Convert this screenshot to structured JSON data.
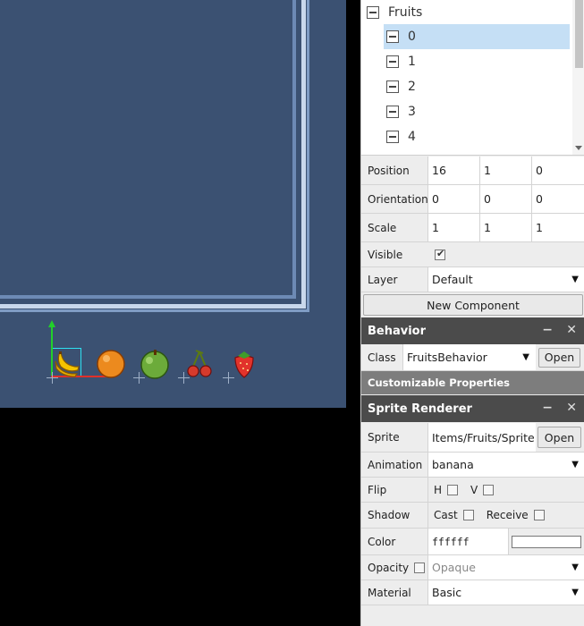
{
  "tree": {
    "root_label": "Fruits",
    "children": [
      "0",
      "1",
      "2",
      "3",
      "4"
    ],
    "selected": "0"
  },
  "transform": {
    "position_label": "Position",
    "position": [
      "16",
      "1",
      "0"
    ],
    "orientation_label": "Orientation",
    "orientation": [
      "0",
      "0",
      "0"
    ],
    "scale_label": "Scale",
    "scale": [
      "1",
      "1",
      "1"
    ],
    "visible_label": "Visible",
    "visible": true,
    "layer_label": "Layer",
    "layer": "Default"
  },
  "new_component_label": "New Component",
  "behavior": {
    "title": "Behavior",
    "class_label": "Class",
    "class_value": "FruitsBehavior",
    "open_label": "Open",
    "customizable_label": "Customizable Properties"
  },
  "sprite_renderer": {
    "title": "Sprite Renderer",
    "sprite_label": "Sprite",
    "sprite_value": "Items/Fruits/Sprite",
    "open_label": "Open",
    "animation_label": "Animation",
    "animation_value": "banana",
    "flip_label": "Flip",
    "flip_h_label": "H",
    "flip_v_label": "V",
    "shadow_label": "Shadow",
    "cast_label": "Cast",
    "receive_label": "Receive",
    "color_label": "Color",
    "color_value": "ffffff",
    "color_swatch": "#ffffff",
    "opacity_label": "Opacity",
    "opacity_value": "Opaque",
    "material_label": "Material",
    "material_value": "Basic"
  },
  "icons": {
    "minimize": "−",
    "close": "✕",
    "caret": "▼"
  },
  "scene": {
    "background": "#3b5172",
    "fruits": [
      "banana",
      "orange",
      "apple",
      "cherries",
      "strawberry"
    ]
  }
}
